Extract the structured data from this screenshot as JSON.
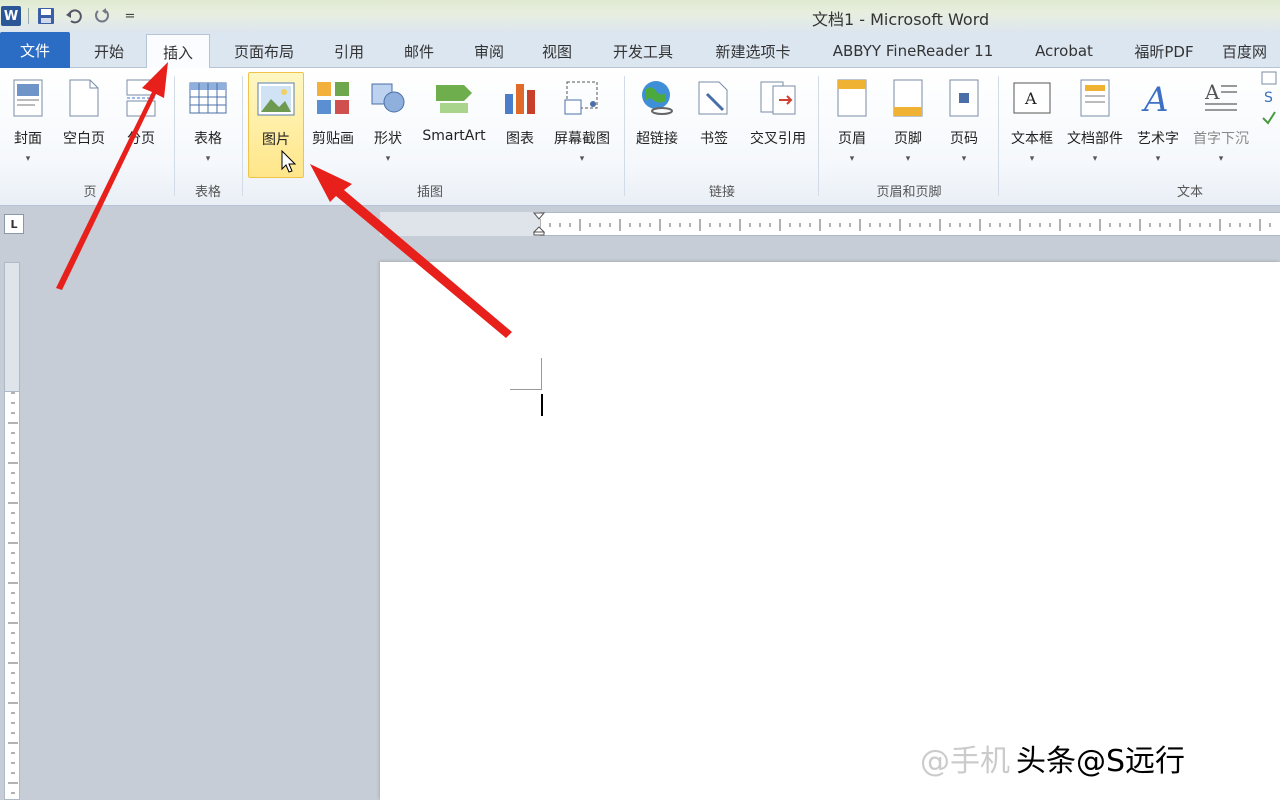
{
  "window": {
    "title": "文档1 - Microsoft Word"
  },
  "qat": {
    "word": "W",
    "separator": "="
  },
  "tabs": {
    "file": "文件",
    "home": "开始",
    "insert": "插入",
    "layout": "页面布局",
    "references": "引用",
    "mailings": "邮件",
    "review": "审阅",
    "view": "视图",
    "developer": "开发工具",
    "new_tab": "新建选项卡",
    "abbyy": "ABBYY FineReader 11",
    "acrobat": "Acrobat",
    "foxit": "福昕PDF",
    "baidu": "百度网"
  },
  "ribbon": {
    "pages": {
      "cover": "封面",
      "blank": "空白页",
      "break": "分页",
      "group": "页"
    },
    "tables": {
      "table": "表格",
      "group": "表格"
    },
    "illustrations": {
      "picture": "图片",
      "clipart": "剪贴画",
      "shapes": "形状",
      "smartart": "SmartArt",
      "chart": "图表",
      "screenshot": "屏幕截图",
      "group": "插图"
    },
    "links": {
      "hyperlink": "超链接",
      "bookmark": "书签",
      "crossref": "交叉引用",
      "group": "链接"
    },
    "header_footer": {
      "header": "页眉",
      "footer": "页脚",
      "page_number": "页码",
      "group": "页眉和页脚"
    },
    "text": {
      "textbox": "文本框",
      "quickparts": "文档部件",
      "wordart": "艺术字",
      "dropcap": "首字下沉",
      "group": "文本"
    }
  },
  "ruler": {
    "corner": "L"
  },
  "watermark": {
    "ghost": "@手机",
    "main": "头条@S远行"
  },
  "colors": {
    "file_tab": "#2b6cc4",
    "highlight": "#ffe68a",
    "arrow": "#e8201c"
  }
}
